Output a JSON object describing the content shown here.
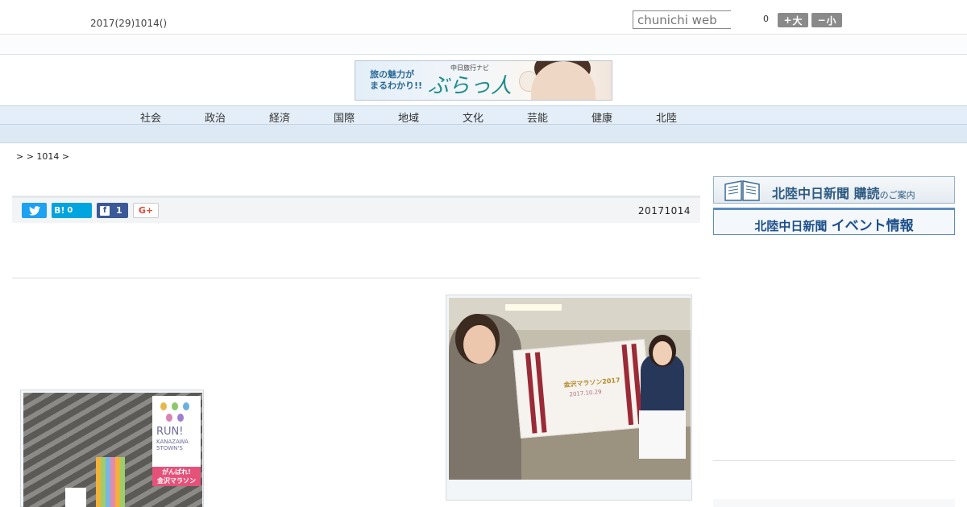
{
  "header": {
    "date": "2017(29)1014()",
    "search_placeholder": "chunichi web",
    "font_size_count": "0",
    "font_larger_label": "大",
    "font_smaller_label": "小"
  },
  "banner": {
    "tagline_line1": "旅の魅力が",
    "tagline_line2": "まるわかり!!",
    "kicker": "中日旅行ナビ",
    "brand": "ぶらっ人"
  },
  "nav": {
    "items": [
      {
        "label": "社会"
      },
      {
        "label": "政治"
      },
      {
        "label": "経済"
      },
      {
        "label": "国際"
      },
      {
        "label": "地域"
      },
      {
        "label": "文化"
      },
      {
        "label": "芸能"
      },
      {
        "label": "健康"
      },
      {
        "label": "北陸"
      }
    ]
  },
  "breadcrumb": {
    "text": ">  > 1014 >"
  },
  "share": {
    "hatena_label": "B!",
    "hatena_count": "0",
    "facebook_count": "1",
    "googleplus_label": "G+",
    "publish_date": "20171014"
  },
  "photos": {
    "main": {
      "towel_text": "金沢マラソン2017",
      "towel_date": "2017.10.29"
    },
    "side": {
      "flag_text": "RUN!",
      "flag_sub1": "KANAZAWA",
      "flag_sub2": "5TOWN'S",
      "flag_banner1": "がんばれ!",
      "flag_banner2": "金沢マラソン"
    }
  },
  "sidebar": {
    "ad1_title": "北陸中日新聞",
    "ad1_emphasis": "購読",
    "ad1_suffix": "のご案内",
    "ad2_title": "北陸中日新聞",
    "ad2_emphasis": "イベント情報"
  },
  "colors": {
    "nav_bg": "#e4eef8",
    "twitter": "#1da1f2",
    "hatena": "#00a4de",
    "facebook": "#3b5998",
    "googleplus": "#dd4b39",
    "sidebar_accent": "#1d4f8a"
  },
  "icons": {
    "twitter": "twitter-bird-icon",
    "hatena": "hatena-bookmark-icon",
    "facebook": "facebook-f-icon",
    "googleplus": "google-plus-icon",
    "plus": "plus-icon",
    "minus": "minus-icon",
    "book": "open-book-icon"
  }
}
